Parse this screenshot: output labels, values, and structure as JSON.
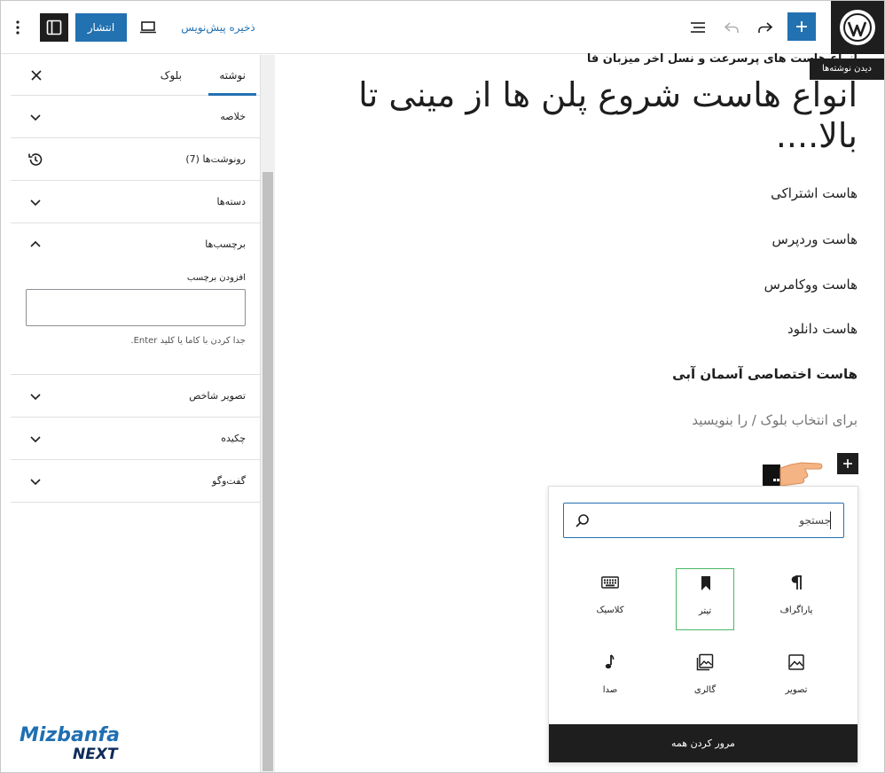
{
  "topbar": {
    "publish_label": "انتشار",
    "save_draft_label": "ذخیره پیش‌نویس",
    "tooltip": "دیدن نوشته‌ها"
  },
  "sidebar": {
    "tabs": [
      {
        "label": "نوشته",
        "active": true
      },
      {
        "label": "بلوک",
        "active": false
      }
    ],
    "panels": {
      "summary": "خلاصه",
      "revisions": "رونوشت‌ها (7)",
      "categories": "دسته‌ها",
      "tags": "برچسب‌ها",
      "featured_image": "تصویر شاخص",
      "excerpt": "چکیده",
      "discussion": "گفت‌وگو"
    },
    "tags_field": {
      "label": "افزودن برچسب",
      "help": "جدا کردن با کاما یا کلید Enter."
    }
  },
  "editor": {
    "heading_small": "انواع هاست های پرسرعت و نسل اخر میزبان فا",
    "heading": "انواع هاست شروع پلن ها از مینی تا بالا....",
    "list": [
      {
        "text": "هاست اشتراکی",
        "bold": false
      },
      {
        "text": "هاست وردپرس",
        "bold": false
      },
      {
        "text": "هاست ووکامرس",
        "bold": false
      },
      {
        "text": "هاست دانلود",
        "bold": false
      },
      {
        "text": "هاست اختصاصی آسمان آبی",
        "bold": true
      }
    ],
    "placeholder": "برای انتخاب بلوک / را بنویسید"
  },
  "inserter": {
    "search_placeholder": "جستجو",
    "blocks": [
      {
        "name": "paragraph",
        "label": "پاراگراف",
        "icon": "pilcrow-icon",
        "selected": false
      },
      {
        "name": "heading",
        "label": "تیتر",
        "icon": "bookmark-icon",
        "selected": true
      },
      {
        "name": "classic",
        "label": "کلاسیک",
        "icon": "keyboard-icon",
        "selected": false
      },
      {
        "name": "image",
        "label": "تصویر",
        "icon": "image-icon",
        "selected": false
      },
      {
        "name": "gallery",
        "label": "گالری",
        "icon": "gallery-icon",
        "selected": false
      },
      {
        "name": "audio",
        "label": "صدا",
        "icon": "music-note-icon",
        "selected": false
      }
    ],
    "browse_all_label": "مرور کردن همه"
  },
  "watermark": {
    "brand": "Mizbanfa",
    "sub": "NEXT"
  },
  "colors": {
    "accent": "#2271b1",
    "dark": "#1e1e1e",
    "selected_border": "#4ab866"
  }
}
